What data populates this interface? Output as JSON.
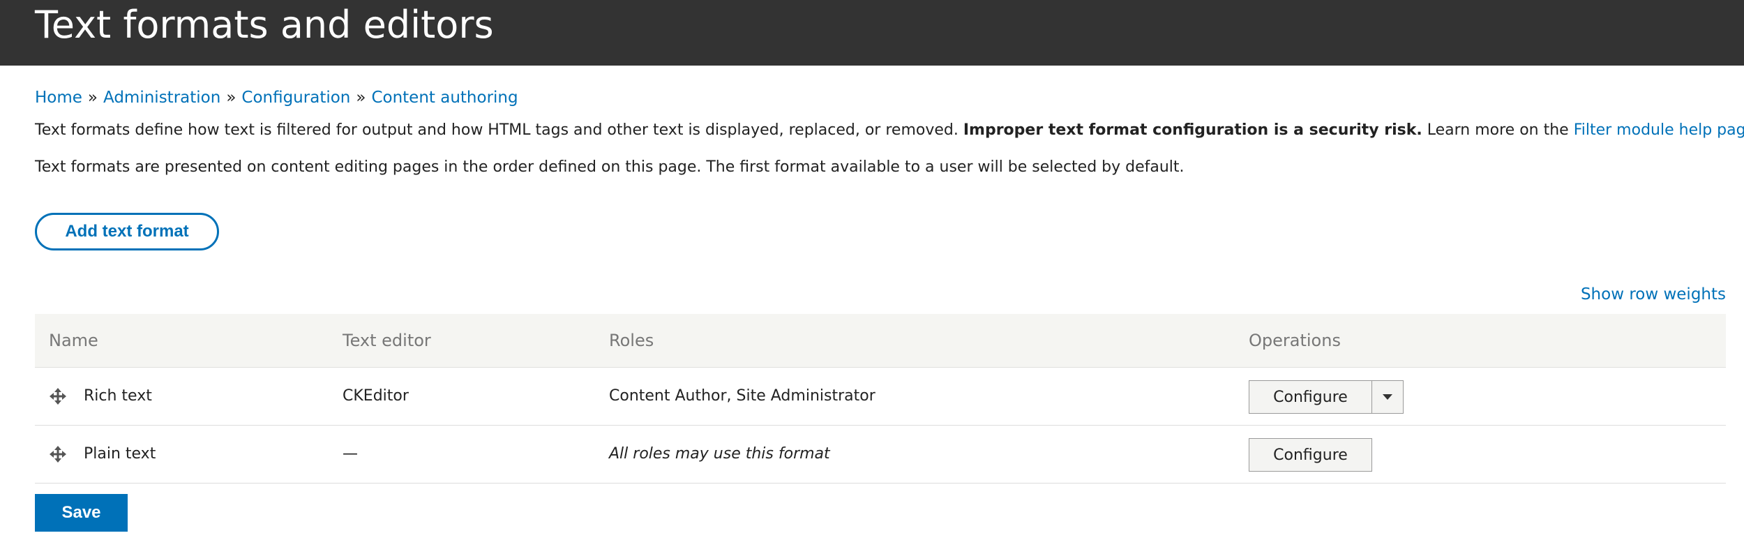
{
  "page": {
    "title": "Text formats and editors"
  },
  "breadcrumb": {
    "items": [
      "Home",
      "Administration",
      "Configuration",
      "Content authoring"
    ],
    "separator": "»"
  },
  "help": {
    "line1_a": "Text formats define how text is filtered for output and how HTML tags and other text is displayed, replaced, or removed. ",
    "line1_bold": "Improper text format configuration is a security risk.",
    "line1_b": " Learn more on the ",
    "line1_link": "Filter module help page",
    "line1_end": ".",
    "line2": "Text formats are presented on content editing pages in the order defined on this page. The first format available to a user will be selected by default."
  },
  "actions": {
    "add_label": "Add text format",
    "show_weights": "Show row weights",
    "save_label": "Save"
  },
  "table": {
    "headers": [
      "Name",
      "Text editor",
      "Roles",
      "Operations"
    ],
    "rows": [
      {
        "name": "Rich text",
        "editor": "CKEditor",
        "roles": "Content Author, Site Administrator",
        "operation": "Configure",
        "has_dropdown": true
      },
      {
        "name": "Plain text",
        "editor": "—",
        "roles": "All roles may use this format",
        "operation": "Configure",
        "has_dropdown": false
      }
    ]
  },
  "icons": {
    "drag_handle": "move-icon",
    "dropdown": "caret-down-icon"
  },
  "colors": {
    "header_bg": "#333333",
    "link": "#0071b8",
    "primary_button": "#0071b8",
    "table_header_bg": "#f5f5f2"
  }
}
